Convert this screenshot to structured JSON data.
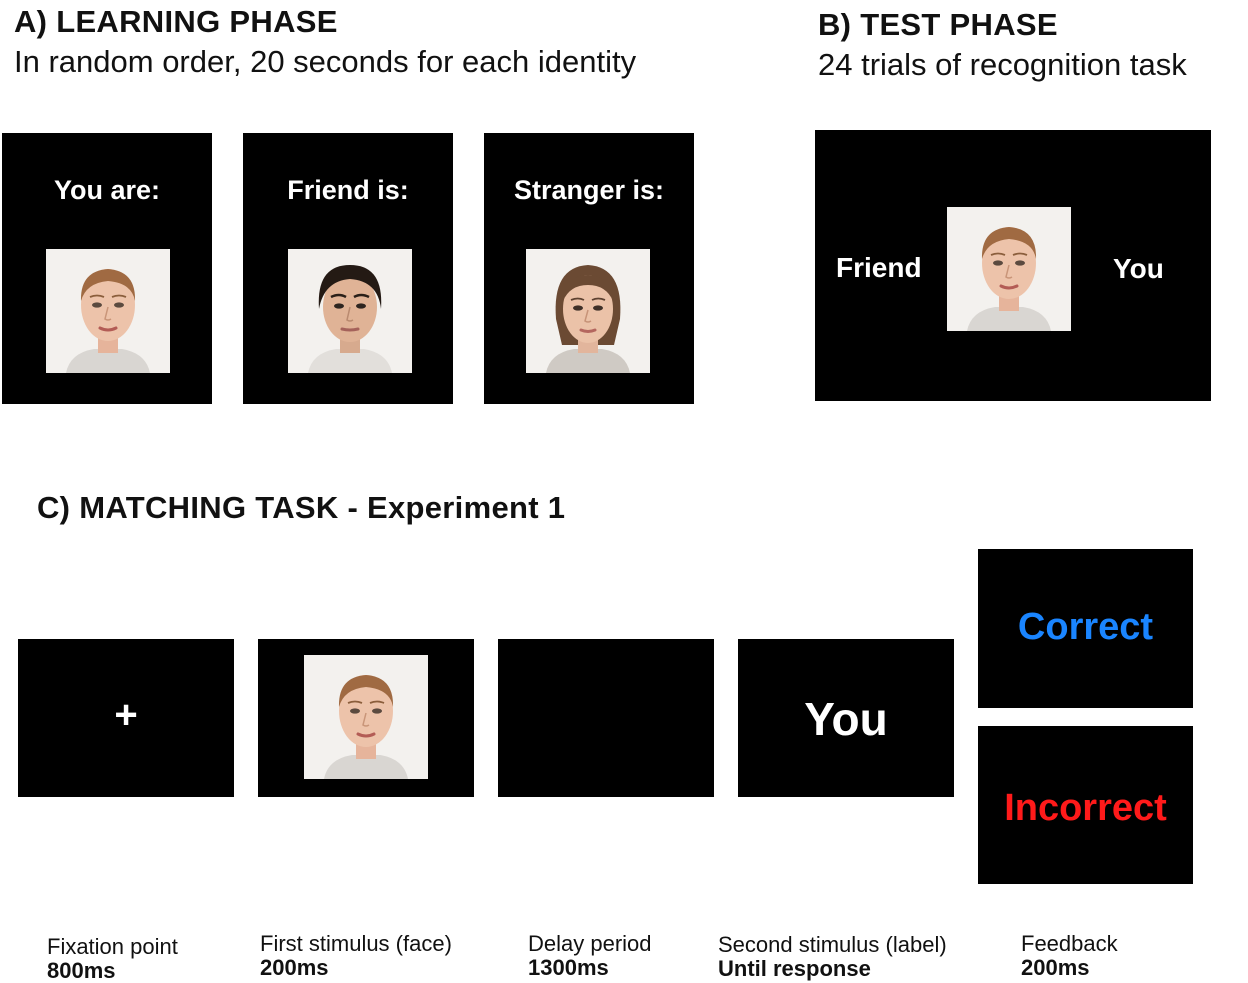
{
  "learning": {
    "heading": "A) LEARNING PHASE",
    "subheading": "In random order, 20 seconds for each identity",
    "cards": [
      {
        "label": "You are:",
        "face": "self-face-photo"
      },
      {
        "label": "Friend is:",
        "face": "friend-face-photo"
      },
      {
        "label": "Stranger is:",
        "face": "stranger-face-photo"
      }
    ]
  },
  "test": {
    "heading": "B) TEST PHASE",
    "subheading": "24 trials of recognition task",
    "left_label": "Friend",
    "right_label": "You"
  },
  "matching": {
    "heading": "C) MATCHING TASK - Experiment 1",
    "fixation_symbol": "+",
    "second_label": "You",
    "feedback_correct": "Correct",
    "feedback_incorrect": "Incorrect",
    "colors": {
      "correct": "#1a85ff",
      "incorrect": "#ff1a1a",
      "panel": "#000000"
    },
    "steps": [
      {
        "name": "Fixation point",
        "duration": "800ms"
      },
      {
        "name": "First stimulus (face)",
        "duration": "200ms"
      },
      {
        "name": "Delay period",
        "duration": "1300ms"
      },
      {
        "name": "Second stimulus (label)",
        "duration": "Until response"
      },
      {
        "name": "Feedback",
        "duration": "200ms"
      }
    ]
  }
}
